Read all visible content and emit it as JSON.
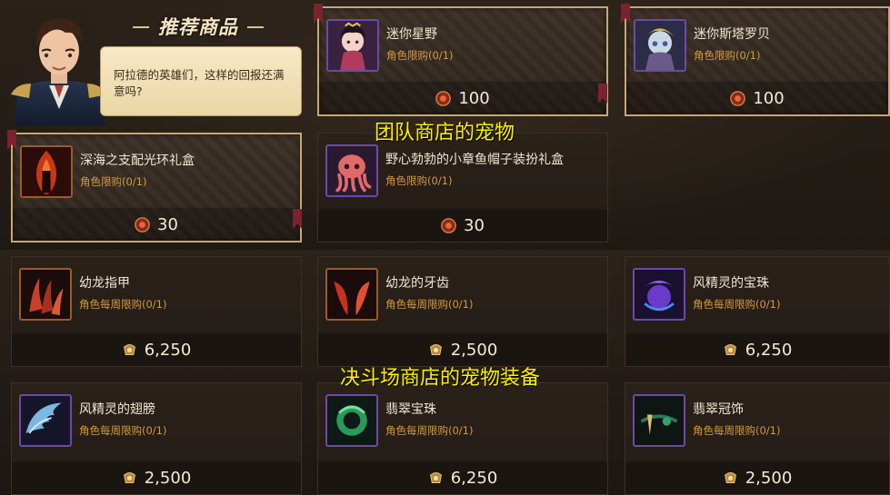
{
  "recommend": {
    "title": "推荐商品",
    "npc_message": "阿拉德的英雄们，这样的回报还满意吗?"
  },
  "overlay_labels": {
    "team_shop": "团队商店的宠物",
    "arena_shop": "决斗场商店的宠物装备"
  },
  "featured_items": [
    {
      "name": "迷你星野",
      "limit": "角色限购(0/1)",
      "price": "100",
      "icon": "mini-hoshino-pet-icon"
    },
    {
      "name": "迷你斯塔罗贝",
      "limit": "角色限购(0/1)",
      "price": "100",
      "icon": "mini-starobe-pet-icon"
    },
    {
      "name": "深海之支配光环礼盒",
      "limit": "角色限购(0/1)",
      "price": "30",
      "icon": "deep-sea-aura-box-icon"
    },
    {
      "name": "野心勃勃的小章鱼帽子装扮礼盒",
      "limit": "角色限购(0/1)",
      "price": "30",
      "icon": "octopus-hat-box-icon"
    }
  ],
  "arena_items": [
    {
      "name": "幼龙指甲",
      "limit": "角色每周限购(0/1)",
      "price": "6,250",
      "icon": "dragon-claw-icon"
    },
    {
      "name": "幼龙的牙齿",
      "limit": "角色每周限购(0/1)",
      "price": "2,500",
      "icon": "dragon-tooth-icon"
    },
    {
      "name": "风精灵的宝珠",
      "limit": "角色每周限购(0/1)",
      "price": "6,250",
      "icon": "wind-spirit-orb-icon"
    },
    {
      "name": "风精灵的翅膀",
      "limit": "角色每周限购(0/1)",
      "price": "2,500",
      "icon": "wind-spirit-wings-icon"
    },
    {
      "name": "翡翠宝珠",
      "limit": "角色每周限购(0/1)",
      "price": "6,250",
      "icon": "jade-orb-icon"
    },
    {
      "name": "翡翠冠饰",
      "limit": "角色每周限购(0/1)",
      "price": "2,500",
      "icon": "jade-crown-icon"
    }
  ],
  "currency_icons": {
    "featured": "red-orb-coin-icon",
    "arena": "gold-medal-coin-icon"
  },
  "colors": {
    "limit_text": "#d49a3c",
    "overlay_text": "#ffee00",
    "featured_border": "#c7a871"
  }
}
